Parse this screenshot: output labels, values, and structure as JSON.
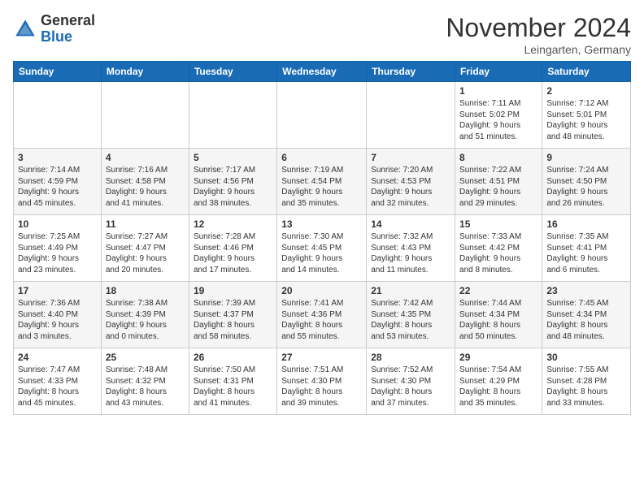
{
  "logo": {
    "general": "General",
    "blue": "Blue"
  },
  "header": {
    "month": "November 2024",
    "location": "Leingarten, Germany"
  },
  "weekdays": [
    "Sunday",
    "Monday",
    "Tuesday",
    "Wednesday",
    "Thursday",
    "Friday",
    "Saturday"
  ],
  "weeks": [
    [
      {
        "day": "",
        "content": ""
      },
      {
        "day": "",
        "content": ""
      },
      {
        "day": "",
        "content": ""
      },
      {
        "day": "",
        "content": ""
      },
      {
        "day": "",
        "content": ""
      },
      {
        "day": "1",
        "content": "Sunrise: 7:11 AM\nSunset: 5:02 PM\nDaylight: 9 hours\nand 51 minutes."
      },
      {
        "day": "2",
        "content": "Sunrise: 7:12 AM\nSunset: 5:01 PM\nDaylight: 9 hours\nand 48 minutes."
      }
    ],
    [
      {
        "day": "3",
        "content": "Sunrise: 7:14 AM\nSunset: 4:59 PM\nDaylight: 9 hours\nand 45 minutes."
      },
      {
        "day": "4",
        "content": "Sunrise: 7:16 AM\nSunset: 4:58 PM\nDaylight: 9 hours\nand 41 minutes."
      },
      {
        "day": "5",
        "content": "Sunrise: 7:17 AM\nSunset: 4:56 PM\nDaylight: 9 hours\nand 38 minutes."
      },
      {
        "day": "6",
        "content": "Sunrise: 7:19 AM\nSunset: 4:54 PM\nDaylight: 9 hours\nand 35 minutes."
      },
      {
        "day": "7",
        "content": "Sunrise: 7:20 AM\nSunset: 4:53 PM\nDaylight: 9 hours\nand 32 minutes."
      },
      {
        "day": "8",
        "content": "Sunrise: 7:22 AM\nSunset: 4:51 PM\nDaylight: 9 hours\nand 29 minutes."
      },
      {
        "day": "9",
        "content": "Sunrise: 7:24 AM\nSunset: 4:50 PM\nDaylight: 9 hours\nand 26 minutes."
      }
    ],
    [
      {
        "day": "10",
        "content": "Sunrise: 7:25 AM\nSunset: 4:49 PM\nDaylight: 9 hours\nand 23 minutes."
      },
      {
        "day": "11",
        "content": "Sunrise: 7:27 AM\nSunset: 4:47 PM\nDaylight: 9 hours\nand 20 minutes."
      },
      {
        "day": "12",
        "content": "Sunrise: 7:28 AM\nSunset: 4:46 PM\nDaylight: 9 hours\nand 17 minutes."
      },
      {
        "day": "13",
        "content": "Sunrise: 7:30 AM\nSunset: 4:45 PM\nDaylight: 9 hours\nand 14 minutes."
      },
      {
        "day": "14",
        "content": "Sunrise: 7:32 AM\nSunset: 4:43 PM\nDaylight: 9 hours\nand 11 minutes."
      },
      {
        "day": "15",
        "content": "Sunrise: 7:33 AM\nSunset: 4:42 PM\nDaylight: 9 hours\nand 8 minutes."
      },
      {
        "day": "16",
        "content": "Sunrise: 7:35 AM\nSunset: 4:41 PM\nDaylight: 9 hours\nand 6 minutes."
      }
    ],
    [
      {
        "day": "17",
        "content": "Sunrise: 7:36 AM\nSunset: 4:40 PM\nDaylight: 9 hours\nand 3 minutes."
      },
      {
        "day": "18",
        "content": "Sunrise: 7:38 AM\nSunset: 4:39 PM\nDaylight: 9 hours\nand 0 minutes."
      },
      {
        "day": "19",
        "content": "Sunrise: 7:39 AM\nSunset: 4:37 PM\nDaylight: 8 hours\nand 58 minutes."
      },
      {
        "day": "20",
        "content": "Sunrise: 7:41 AM\nSunset: 4:36 PM\nDaylight: 8 hours\nand 55 minutes."
      },
      {
        "day": "21",
        "content": "Sunrise: 7:42 AM\nSunset: 4:35 PM\nDaylight: 8 hours\nand 53 minutes."
      },
      {
        "day": "22",
        "content": "Sunrise: 7:44 AM\nSunset: 4:34 PM\nDaylight: 8 hours\nand 50 minutes."
      },
      {
        "day": "23",
        "content": "Sunrise: 7:45 AM\nSunset: 4:34 PM\nDaylight: 8 hours\nand 48 minutes."
      }
    ],
    [
      {
        "day": "24",
        "content": "Sunrise: 7:47 AM\nSunset: 4:33 PM\nDaylight: 8 hours\nand 45 minutes."
      },
      {
        "day": "25",
        "content": "Sunrise: 7:48 AM\nSunset: 4:32 PM\nDaylight: 8 hours\nand 43 minutes."
      },
      {
        "day": "26",
        "content": "Sunrise: 7:50 AM\nSunset: 4:31 PM\nDaylight: 8 hours\nand 41 minutes."
      },
      {
        "day": "27",
        "content": "Sunrise: 7:51 AM\nSunset: 4:30 PM\nDaylight: 8 hours\nand 39 minutes."
      },
      {
        "day": "28",
        "content": "Sunrise: 7:52 AM\nSunset: 4:30 PM\nDaylight: 8 hours\nand 37 minutes."
      },
      {
        "day": "29",
        "content": "Sunrise: 7:54 AM\nSunset: 4:29 PM\nDaylight: 8 hours\nand 35 minutes."
      },
      {
        "day": "30",
        "content": "Sunrise: 7:55 AM\nSunset: 4:28 PM\nDaylight: 8 hours\nand 33 minutes."
      }
    ]
  ]
}
